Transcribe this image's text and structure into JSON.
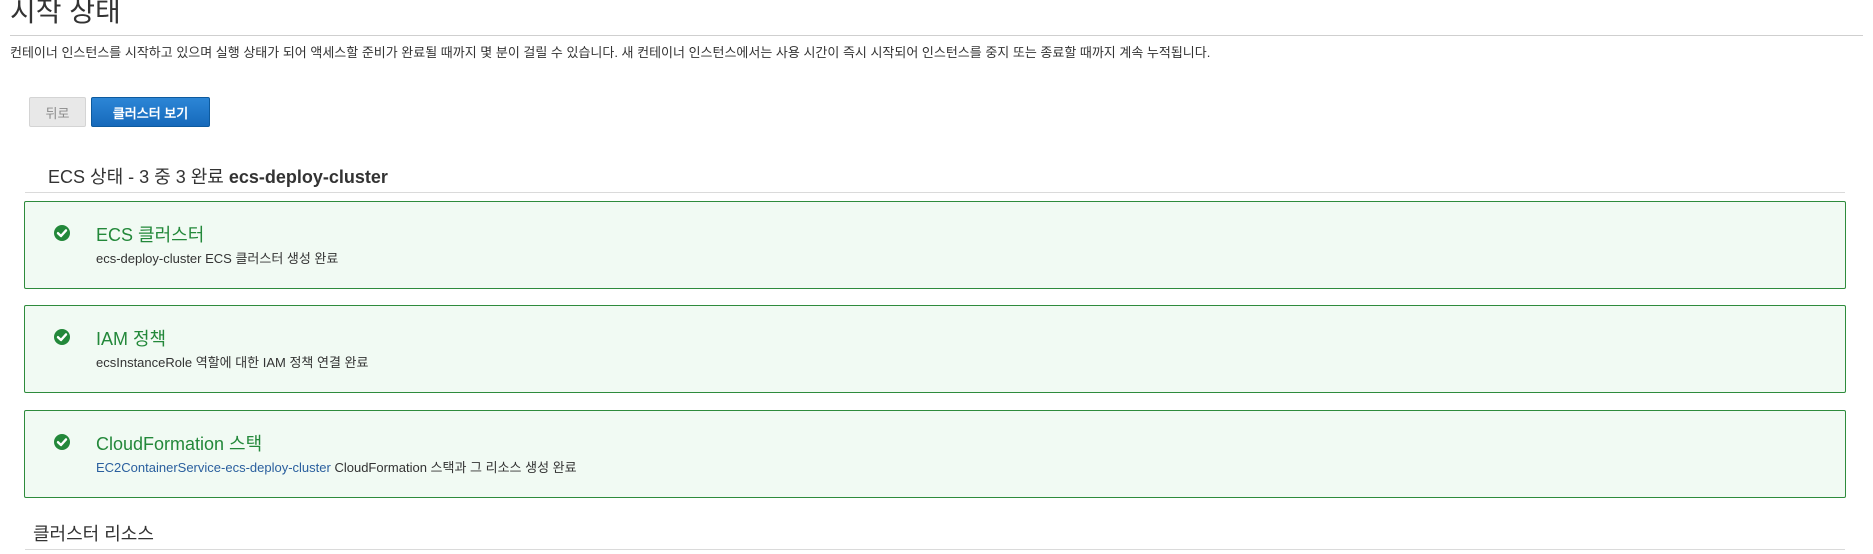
{
  "page": {
    "title": "시작 상태",
    "description": "컨테이너 인스턴스를 시작하고 있으며 실행 상태가 되어 액세스할 준비가 완료될 때까지 몇 분이 걸릴 수 있습니다. 새 컨테이너 인스턴스에서는 사용 시간이 즉시 시작되어 인스턴스를 중지 또는 종료할 때까지 계속 누적됩니다."
  },
  "buttons": {
    "back_label": "뒤로",
    "view_cluster_label": "클러스터 보기"
  },
  "status": {
    "prefix": "ECS 상태 - 3 중 3 완료",
    "cluster_name": "ecs-deploy-cluster"
  },
  "steps": [
    {
      "title": "ECS 클러스터",
      "description": "ecs-deploy-cluster ECS 클러스터 생성 완료",
      "icon": "check-circle-icon"
    },
    {
      "title": "IAM 정책",
      "description": "ecsInstanceRole 역할에 대한 IAM 정책 연결 완료",
      "icon": "check-circle-icon"
    },
    {
      "title": "CloudFormation 스택",
      "link_text": "EC2ContainerService-ecs-deploy-cluster",
      "description": "CloudFormation 스택과 그 리소스 생성 완료",
      "icon": "check-circle-icon"
    }
  ],
  "resources": {
    "title": "클러스터 리소스"
  },
  "colors": {
    "success_green": "#23883a",
    "card_background": "#f1faf3",
    "primary_button": "#1669bb",
    "link_blue": "#2a5f9e"
  }
}
